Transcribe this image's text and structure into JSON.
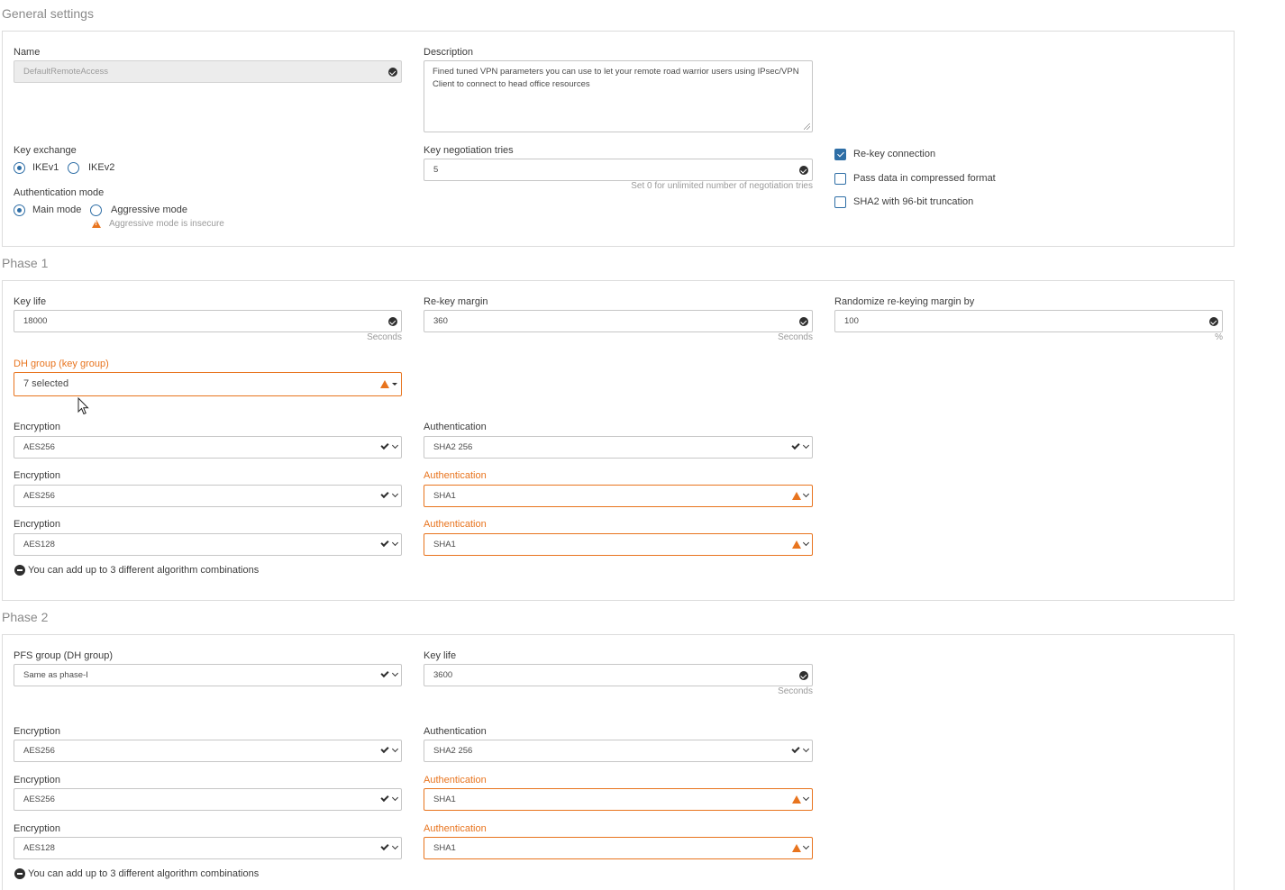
{
  "general": {
    "title": "General settings",
    "name_label": "Name",
    "name_value": "DefaultRemoteAccess",
    "description_label": "Description",
    "description_value": "Fined tuned VPN parameters you can use to let your remote road warrior users using IPsec/VPN Client to connect to head office resources",
    "key_exchange_label": "Key exchange",
    "key_exchange_options": [
      "IKEv1",
      "IKEv2"
    ],
    "key_exchange_selected": "IKEv1",
    "key_negotiation_label": "Key negotiation tries",
    "key_negotiation_value": "5",
    "key_negotiation_hint": "Set 0 for unlimited number of negotiation tries",
    "auth_mode_label": "Authentication mode",
    "auth_mode_options": [
      "Main mode",
      "Aggressive mode"
    ],
    "auth_mode_selected": "Main mode",
    "aggressive_warning": "Aggressive mode is insecure",
    "checkboxes": [
      {
        "label": "Re-key connection",
        "checked": true
      },
      {
        "label": "Pass data in compressed format",
        "checked": false
      },
      {
        "label": "SHA2 with 96-bit truncation",
        "checked": false
      }
    ]
  },
  "phase1": {
    "title": "Phase 1",
    "key_life_label": "Key life",
    "key_life_value": "18000",
    "key_life_unit": "Seconds",
    "rekey_margin_label": "Re-key margin",
    "rekey_margin_value": "360",
    "rekey_margin_unit": "Seconds",
    "randomize_label": "Randomize re-keying margin by",
    "randomize_value": "100",
    "randomize_unit": "%",
    "dh_group_label": "DH group (key group)",
    "dh_group_value": "7 selected",
    "combos": [
      {
        "enc_label": "Encryption",
        "enc_value": "AES256",
        "auth_label": "Authentication",
        "auth_value": "SHA2 256",
        "auth_warn": false
      },
      {
        "enc_label": "Encryption",
        "enc_value": "AES256",
        "auth_label": "Authentication",
        "auth_value": "SHA1",
        "auth_warn": true
      },
      {
        "enc_label": "Encryption",
        "enc_value": "AES128",
        "auth_label": "Authentication",
        "auth_value": "SHA1",
        "auth_warn": true
      }
    ],
    "combo_note": "You can add up to 3 different algorithm combinations"
  },
  "phase2": {
    "title": "Phase 2",
    "pfs_label": "PFS group (DH group)",
    "pfs_value": "Same as phase-I",
    "key_life_label": "Key life",
    "key_life_value": "3600",
    "key_life_unit": "Seconds",
    "combos": [
      {
        "enc_label": "Encryption",
        "enc_value": "AES256",
        "auth_label": "Authentication",
        "auth_value": "SHA2 256",
        "auth_warn": false
      },
      {
        "enc_label": "Encryption",
        "enc_value": "AES256",
        "auth_label": "Authentication",
        "auth_value": "SHA1",
        "auth_warn": true
      },
      {
        "enc_label": "Encryption",
        "enc_value": "AES128",
        "auth_label": "Authentication",
        "auth_value": "SHA1",
        "auth_warn": true
      }
    ],
    "combo_note": "You can add up to 3 different algorithm combinations"
  },
  "colors": {
    "accent": "#2e6ea6",
    "warning": "#e8741e",
    "border": "#dcdcdc"
  }
}
